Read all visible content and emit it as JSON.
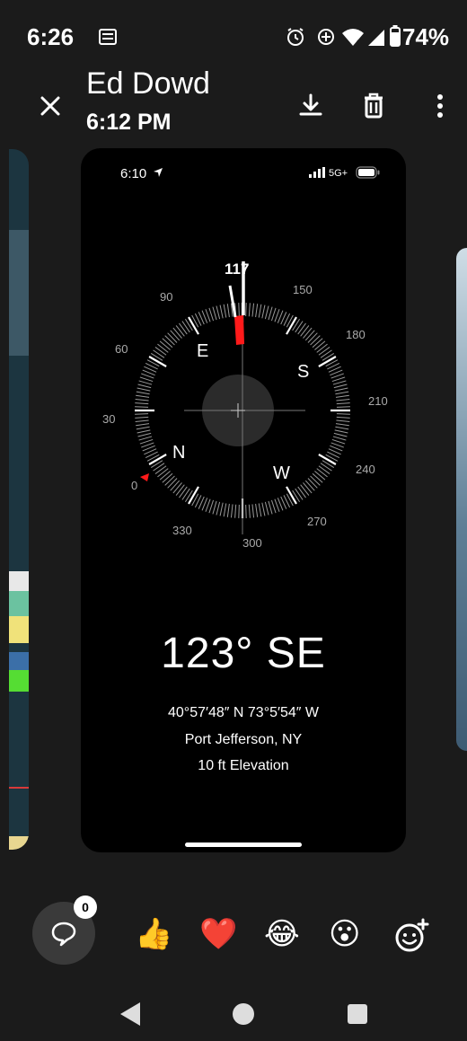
{
  "status_bar": {
    "time": "6:26",
    "battery": "74%",
    "icons": [
      "notification-icon",
      "alarm-icon",
      "data-saver-icon",
      "wifi-icon",
      "signal-icon",
      "battery-icon"
    ]
  },
  "header": {
    "sender": "Ed Dowd",
    "time": "6:12 PM",
    "icons": [
      "close-icon",
      "download-icon",
      "delete-icon",
      "more-icon"
    ]
  },
  "screenshot": {
    "status_time": "6:10",
    "network": "5G+",
    "compass": {
      "marker_value": "117",
      "degree_labels": [
        "0",
        "30",
        "60",
        "90",
        "150",
        "180",
        "210",
        "240",
        "270",
        "300",
        "330"
      ],
      "cardinals": [
        "N",
        "E",
        "S",
        "W"
      ]
    },
    "heading": "123° SE",
    "coordinates": "40°57′48″ N  73°5′54″ W",
    "location": "Port Jefferson, NY",
    "elevation": "10 ft Elevation"
  },
  "reactions": {
    "reply_count": "0",
    "emojis": [
      "👍",
      "❤️",
      "😂",
      "😮"
    ],
    "icons": [
      "reply-icon",
      "add-reaction-icon"
    ]
  },
  "nav_bar": {
    "icons": [
      "back-icon",
      "home-icon",
      "recents-icon"
    ]
  },
  "colors": {
    "background": "#1b1b1b",
    "card": "#000000",
    "compass_accent": "#ff1a1a"
  }
}
